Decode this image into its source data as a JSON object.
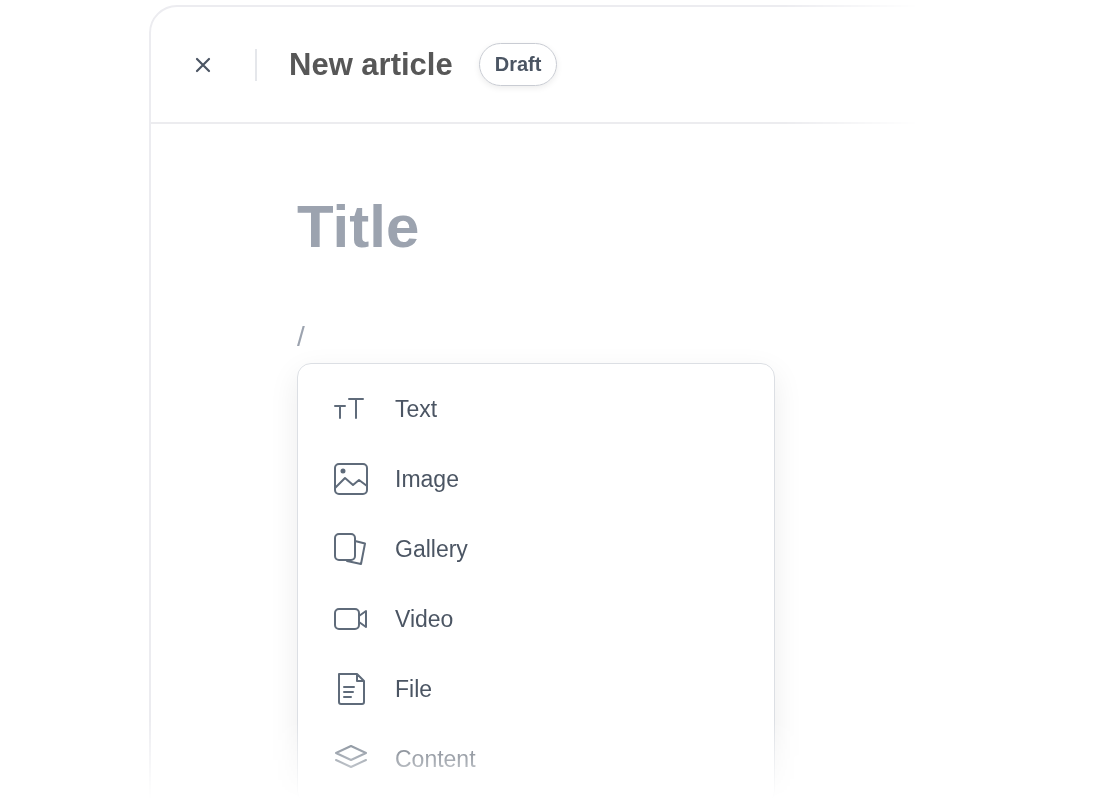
{
  "header": {
    "title": "New article",
    "status": "Draft"
  },
  "editor": {
    "title": {
      "placeholder": "Title"
    },
    "command": {
      "value": "/"
    }
  },
  "menu": [
    {
      "label": "Text",
      "kind": "text"
    },
    {
      "label": "Image",
      "kind": "image"
    },
    {
      "label": "Gallery",
      "kind": "gallery"
    },
    {
      "label": "Video",
      "kind": "video"
    },
    {
      "label": "File",
      "kind": "file"
    },
    {
      "label": "Content",
      "kind": "content"
    }
  ]
}
